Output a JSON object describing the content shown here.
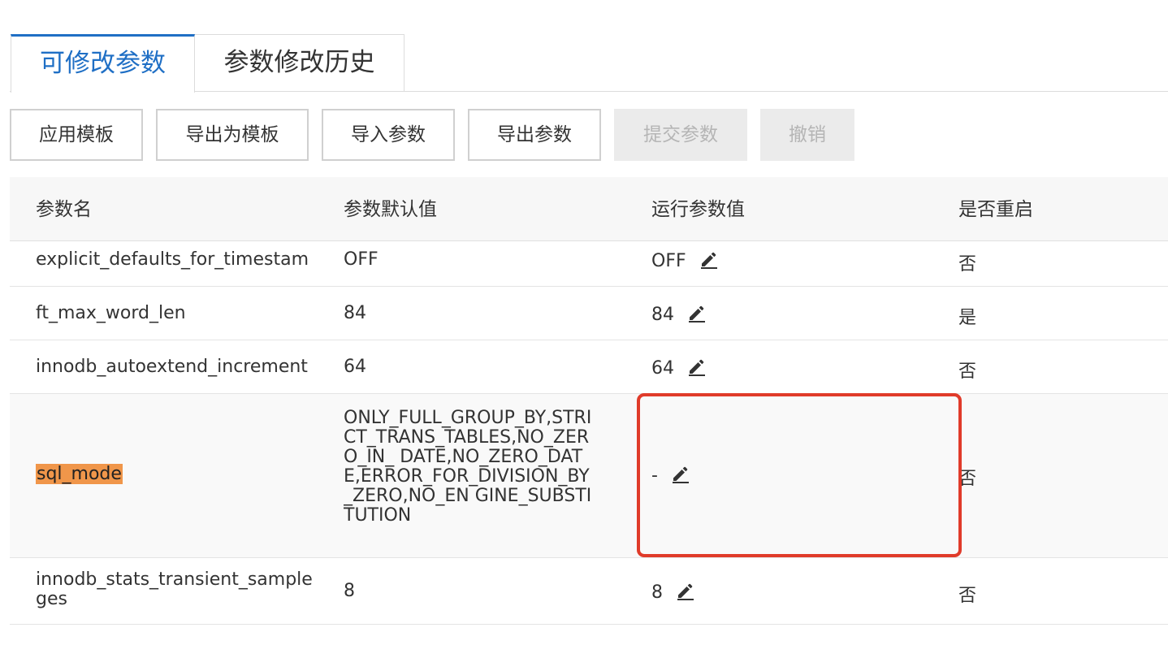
{
  "tabs": [
    {
      "label": "可修改参数",
      "active": true
    },
    {
      "label": "参数修改历史",
      "active": false
    }
  ],
  "toolbar": {
    "apply_template": "应用模板",
    "export_as_template": "导出为模板",
    "import_params": "导入参数",
    "export_params": "导出参数",
    "submit_params": "提交参数",
    "undo": "撤销"
  },
  "table": {
    "headers": [
      "参数名",
      "参数默认值",
      "运行参数值",
      "是否重启"
    ],
    "rows": [
      {
        "name": "explicit_defaults_for_timestam",
        "default": "OFF",
        "value": "OFF",
        "restart": "否"
      },
      {
        "name": "ft_max_word_len",
        "default": "84",
        "value": "84",
        "restart": "是"
      },
      {
        "name": "innodb_autoextend_increment",
        "default": "64",
        "value": "64",
        "restart": "否"
      },
      {
        "name": "sql_mode",
        "default": "ONLY_FULL_GROUP_BY,STRICT_TRANS_TABLES,NO_ZERO_IN_ DATE,NO_ZERO_DATE,ERROR_FOR_DIVISION_BY_ZERO,NO_EN GINE_SUBSTITUTION",
        "value": "-",
        "restart": "否"
      },
      {
        "name": "innodb_stats_transient_sample ges",
        "default": "8",
        "value": "8",
        "restart": "否"
      }
    ]
  },
  "icons": {
    "edit": "pencil-edit-icon"
  },
  "colors": {
    "accent": "#1f6fc5",
    "highlight": "#f0964a",
    "annotation": "#e03b2a"
  }
}
